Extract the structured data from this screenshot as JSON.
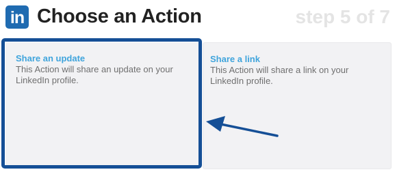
{
  "header": {
    "logo_text": "in",
    "title": "Choose an Action",
    "step": "step 5 of 7"
  },
  "actions": [
    {
      "title": "Share an update",
      "description": "This Action will share an update on your LinkedIn profile.",
      "selected": true
    },
    {
      "title": "Share a link",
      "description": "This Action will share a link on your LinkedIn profile.",
      "selected": false
    }
  ],
  "colors": {
    "brand_blue": "#1f6bb1",
    "highlight_border": "#154f96",
    "action_title": "#3fa4dc",
    "step_text": "#e4e4e4"
  },
  "annotation": {
    "arrow_icon": "arrow-left-icon"
  }
}
